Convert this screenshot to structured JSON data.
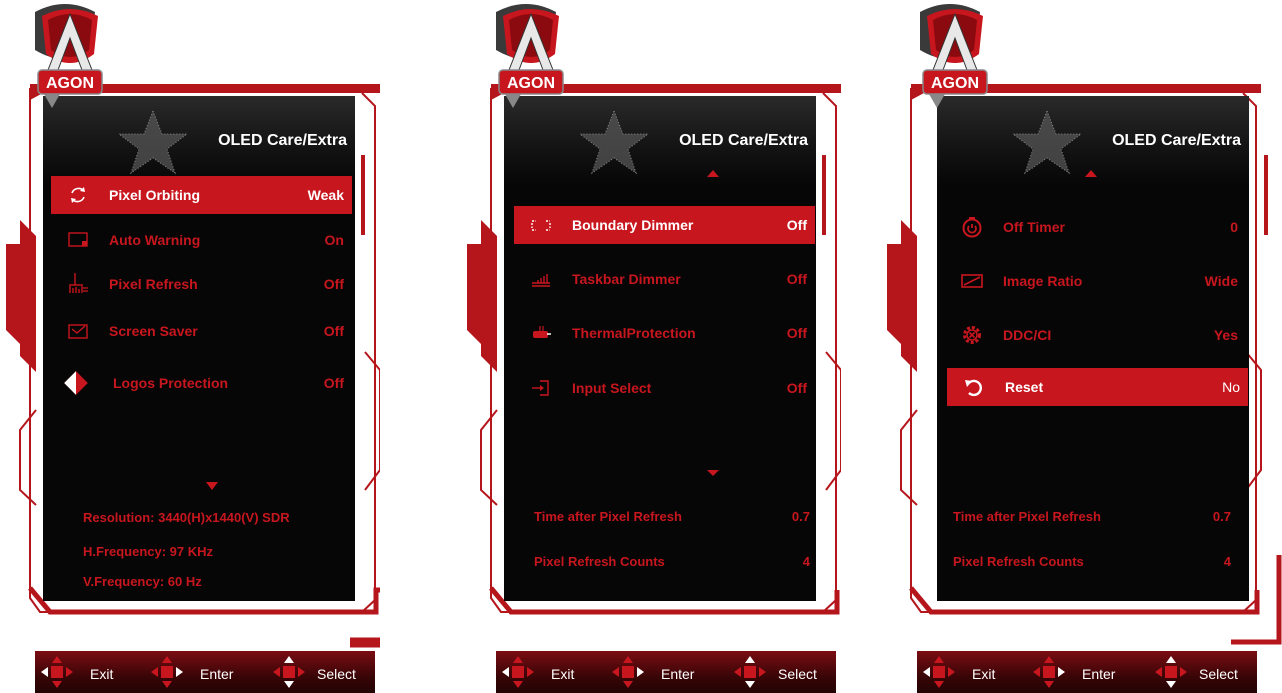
{
  "brand": "AGON",
  "colors": {
    "accent": "#c8161e",
    "background": "#060606",
    "text_selected": "#ffffff"
  },
  "panels": [
    {
      "title": "OLED Care/Extra",
      "items": [
        {
          "label": "Pixel Orbiting",
          "value": "Weak",
          "icon": "pixel-orbiting-icon",
          "selected": true
        },
        {
          "label": "Auto Warning",
          "value": "On",
          "icon": "auto-warning-icon",
          "selected": false
        },
        {
          "label": "Pixel Refresh",
          "value": "Off",
          "icon": "pixel-refresh-icon",
          "selected": false
        },
        {
          "label": "Screen Saver",
          "value": "Off",
          "icon": "screen-saver-icon",
          "selected": false
        },
        {
          "label": "Logos Protection",
          "value": "Off",
          "icon": "logos-protection-icon",
          "selected": false
        }
      ],
      "info": [
        "Resolution: 3440(H)x1440(V) SDR",
        "H.Frequency: 97 KHz",
        "V.Frequency: 60 Hz"
      ]
    },
    {
      "title": "OLED Care/Extra",
      "items": [
        {
          "label": "Boundary Dimmer",
          "value": "Off",
          "icon": "boundary-dimmer-icon",
          "selected": true
        },
        {
          "label": "Taskbar Dimmer",
          "value": "Off",
          "icon": "taskbar-dimmer-icon",
          "selected": false
        },
        {
          "label": "ThermalProtection",
          "value": "Off",
          "icon": "thermal-protection-icon",
          "selected": false
        },
        {
          "label": "Input Select",
          "value": "Off",
          "icon": "input-select-icon",
          "selected": false
        }
      ],
      "stats": [
        {
          "label": "Time after Pixel Refresh",
          "value": "0.7"
        },
        {
          "label": "Pixel Refresh Counts",
          "value": "4"
        }
      ]
    },
    {
      "title": "OLED Care/Extra",
      "items": [
        {
          "label": "Off Timer",
          "value": "0",
          "icon": "off-timer-icon",
          "selected": false
        },
        {
          "label": "Image Ratio",
          "value": "Wide",
          "icon": "image-ratio-icon",
          "selected": false
        },
        {
          "label": "DDC/CI",
          "value": "Yes",
          "icon": "ddc-ci-icon",
          "selected": false
        },
        {
          "label": "Reset",
          "value": "No",
          "icon": "reset-icon",
          "selected": true
        }
      ],
      "stats": [
        {
          "label": "Time after Pixel Refresh",
          "value": "0.7"
        },
        {
          "label": "Pixel Refresh Counts",
          "value": "4"
        }
      ]
    }
  ],
  "nav": {
    "exit": "Exit",
    "enter": "Enter",
    "select": "Select"
  }
}
